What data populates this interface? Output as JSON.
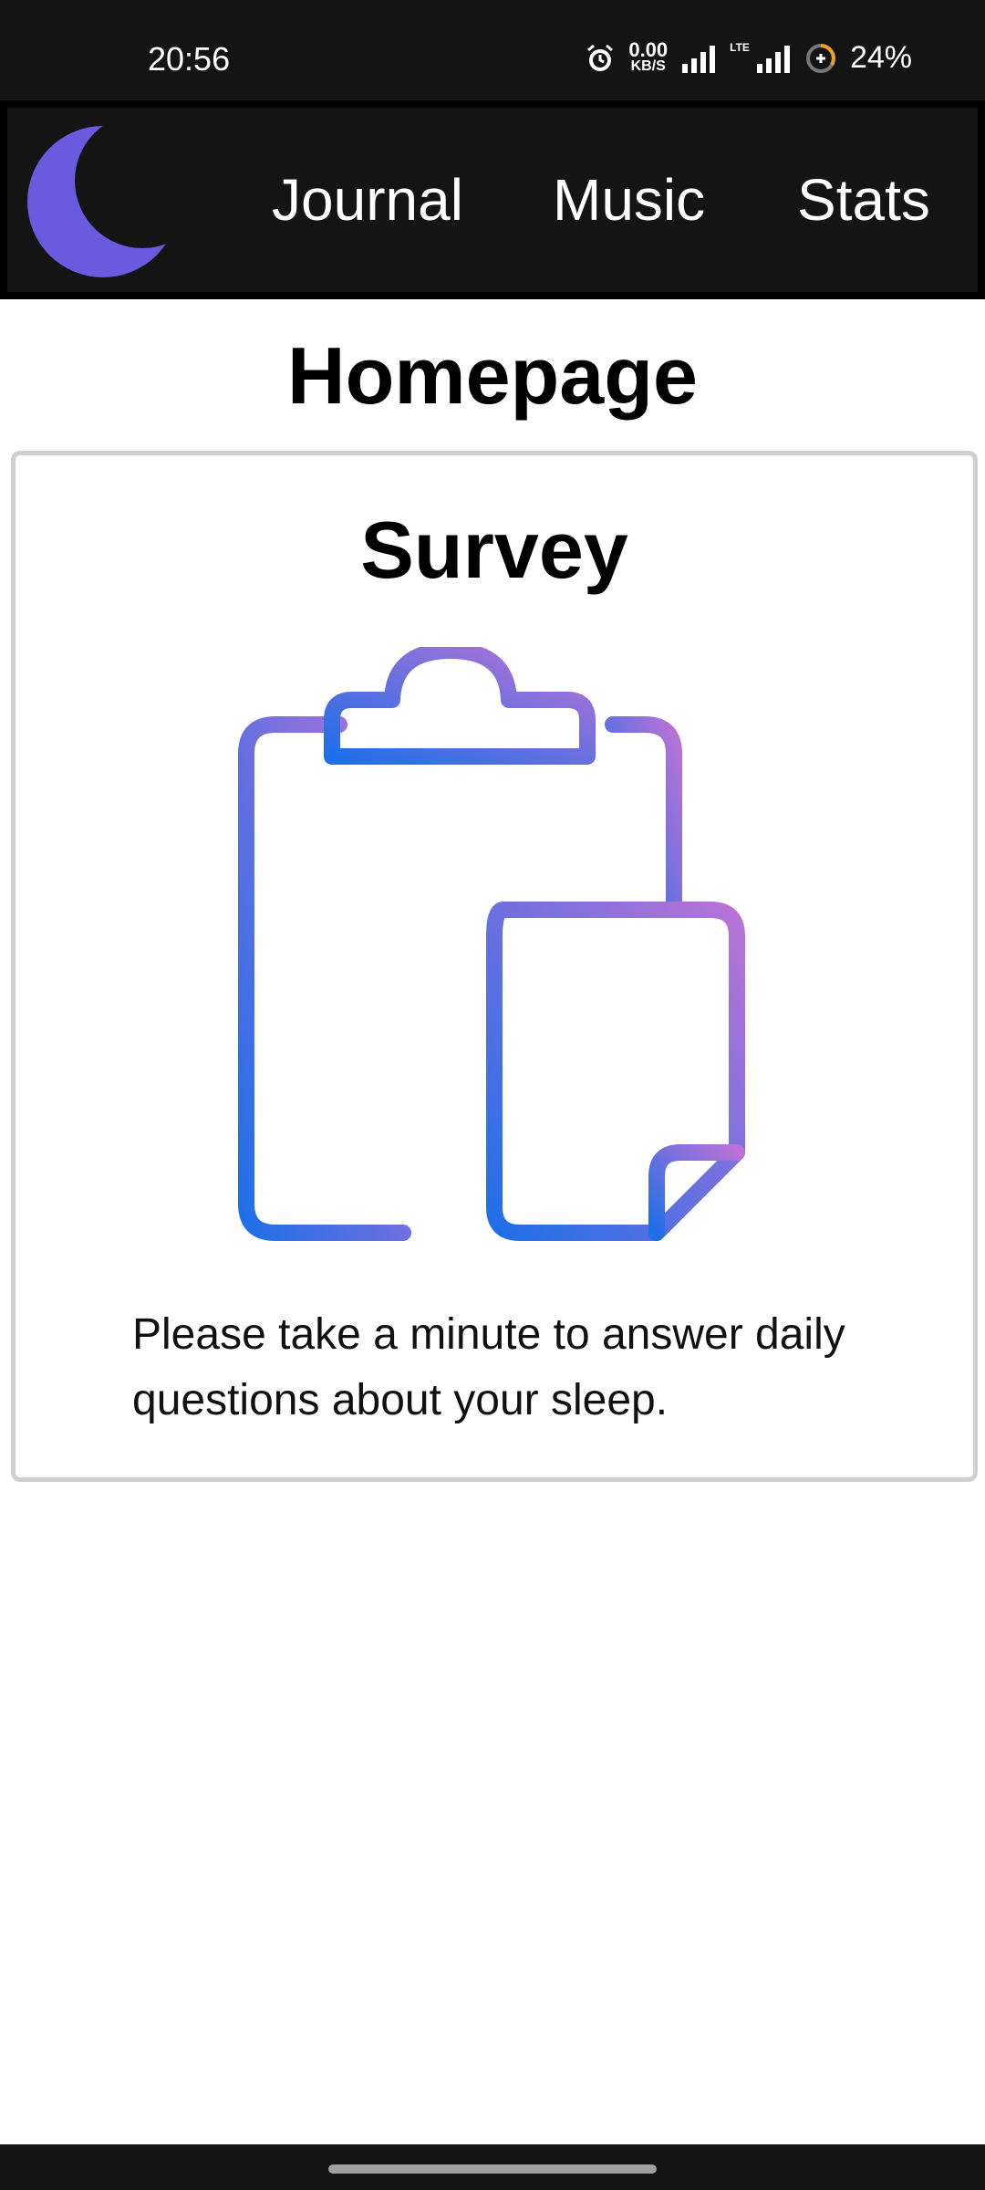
{
  "status_bar": {
    "time": "20:56",
    "net_speed_value": "0.00",
    "net_speed_unit": "KB/S",
    "network_type": "LTE",
    "battery_percent": "24%",
    "icons": [
      "alarm-icon",
      "signal-icon",
      "lte-signal-icon",
      "battery-saver-icon"
    ]
  },
  "nav": {
    "logo_icon": "moon-icon",
    "logo_color": "#6a5ae0",
    "links": [
      {
        "label": "Journal"
      },
      {
        "label": "Music"
      },
      {
        "label": "Stats"
      }
    ]
  },
  "page": {
    "title": "Homepage"
  },
  "survey_card": {
    "title": "Survey",
    "icon": "clipboard-document-icon",
    "gradient_colors": [
      "#1f6fe8",
      "#b972d6"
    ],
    "description": "Please take a minute to answer daily questions about your sleep."
  }
}
